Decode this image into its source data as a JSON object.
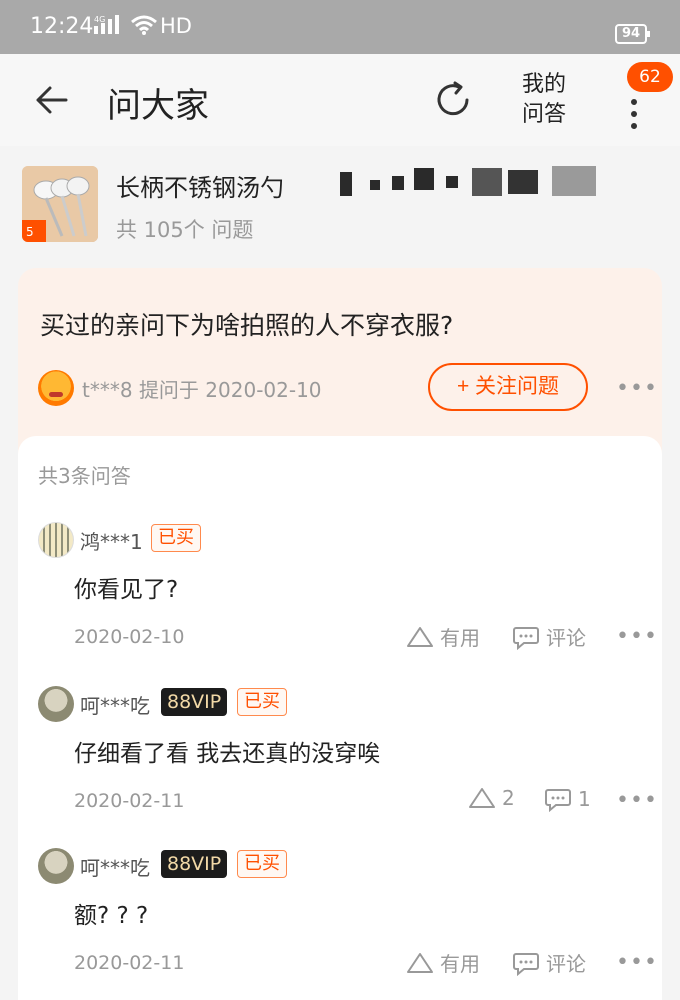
{
  "status_bar": {
    "time": "12:24",
    "network": "4G",
    "hd": "HD",
    "battery": "94"
  },
  "nav": {
    "title": "问大家",
    "my_qa_line1": "我的",
    "my_qa_line2": "问答",
    "badge": "62"
  },
  "product": {
    "title": "长柄不锈钢汤勺",
    "question_count": "共 105个 问题",
    "thumbnail_label": "5"
  },
  "question": {
    "title": "买过的亲问下为啥拍照的人不穿衣服?",
    "asker": "t***8",
    "asked_at": "提问于 2020-02-10",
    "follow_label": "+ 关注问题",
    "more": "•••"
  },
  "answers": {
    "total": "共3条问答",
    "items": [
      {
        "user": "鸿***1",
        "vip": "",
        "bought": "已买",
        "text": "你看见了?",
        "date": "2020-02-10",
        "useful": "有用",
        "comment": "评论",
        "more": "•••"
      },
      {
        "user": "呵***吃",
        "vip": "88VIP",
        "bought": "已买",
        "text": "仔细看了看  我去还真的没穿唉",
        "date": "2020-02-11",
        "useful": "2",
        "comment": "1",
        "more": "•••"
      },
      {
        "user": "呵***吃",
        "vip": "88VIP",
        "bought": "已买",
        "text": "额? ? ?",
        "date": "2020-02-11",
        "useful": "有用",
        "comment": "评论",
        "more": "•••"
      }
    ]
  },
  "colors": {
    "accent": "#ff5000",
    "status_bar": "#a9a9a9",
    "question_bg": "#fdf1ea"
  }
}
